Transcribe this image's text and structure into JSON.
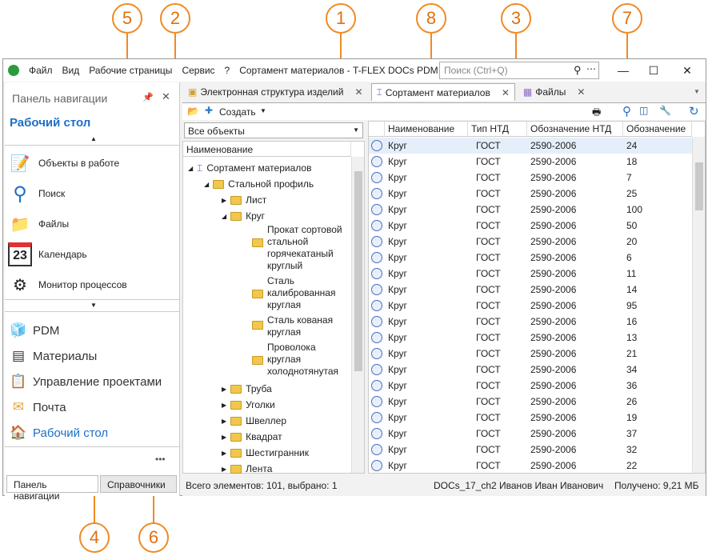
{
  "callouts": [
    "1",
    "2",
    "3",
    "4",
    "5",
    "6",
    "7",
    "8"
  ],
  "menu": {
    "file": "Файл",
    "view": "Вид",
    "workspaces": "Рабочие страницы",
    "service": "Сервис",
    "help": "?"
  },
  "window_title": "Сортамент материалов - T-FLEX DOCs PDM",
  "search_placeholder": "Поиск (Ctrl+Q)",
  "nav": {
    "title": "Панель навигации",
    "section": "Рабочий стол",
    "items": [
      "Объекты в работе",
      "Поиск",
      "Файлы",
      "Календарь",
      "Монитор процессов"
    ],
    "calendar_day": "23",
    "bottom_items": [
      "PDM",
      "Материалы",
      "Управление проектами",
      "Почта",
      "Рабочий стол"
    ],
    "tabs": [
      "Панель навигации",
      "Справочники"
    ],
    "more": "•••"
  },
  "tabs": [
    "Электронная структура изделий",
    "Сортамент материалов",
    "Файлы"
  ],
  "toolbar": {
    "create": "Создать"
  },
  "filter": "Все объекты",
  "tree": {
    "header": "Наименование",
    "root": "Сортамент материалов",
    "steel": "Стальной профиль",
    "sheet": "Лист",
    "circle": "Круг",
    "leaf1": "Прокат сортовой стальной горячекатаный круглый",
    "leaf2": "Сталь калиброванная круглая",
    "leaf3": "Сталь кованая круглая",
    "leaf4": "Проволока круглая холоднотянутая",
    "rest": [
      "Труба",
      "Уголки",
      "Швеллер",
      "Квадрат",
      "Шестигранник",
      "Лента"
    ]
  },
  "grid": {
    "headers": [
      "Наименование",
      "Тип НТД",
      "Обозначение НТД",
      "Обозначение"
    ],
    "name": "Круг",
    "type": "ГОСТ",
    "ntd": "2590-2006",
    "values": [
      "24",
      "18",
      "7",
      "25",
      "100",
      "50",
      "20",
      "6",
      "11",
      "14",
      "95",
      "16",
      "13",
      "21",
      "34",
      "36",
      "26",
      "19",
      "37",
      "32",
      "22"
    ]
  },
  "status": {
    "count": "Всего элементов: 101, выбрано: 1",
    "server": "DOCs_17_ch2",
    "user": "Иванов Иван Иванович",
    "received": "Получено: 9,21 МБ"
  }
}
